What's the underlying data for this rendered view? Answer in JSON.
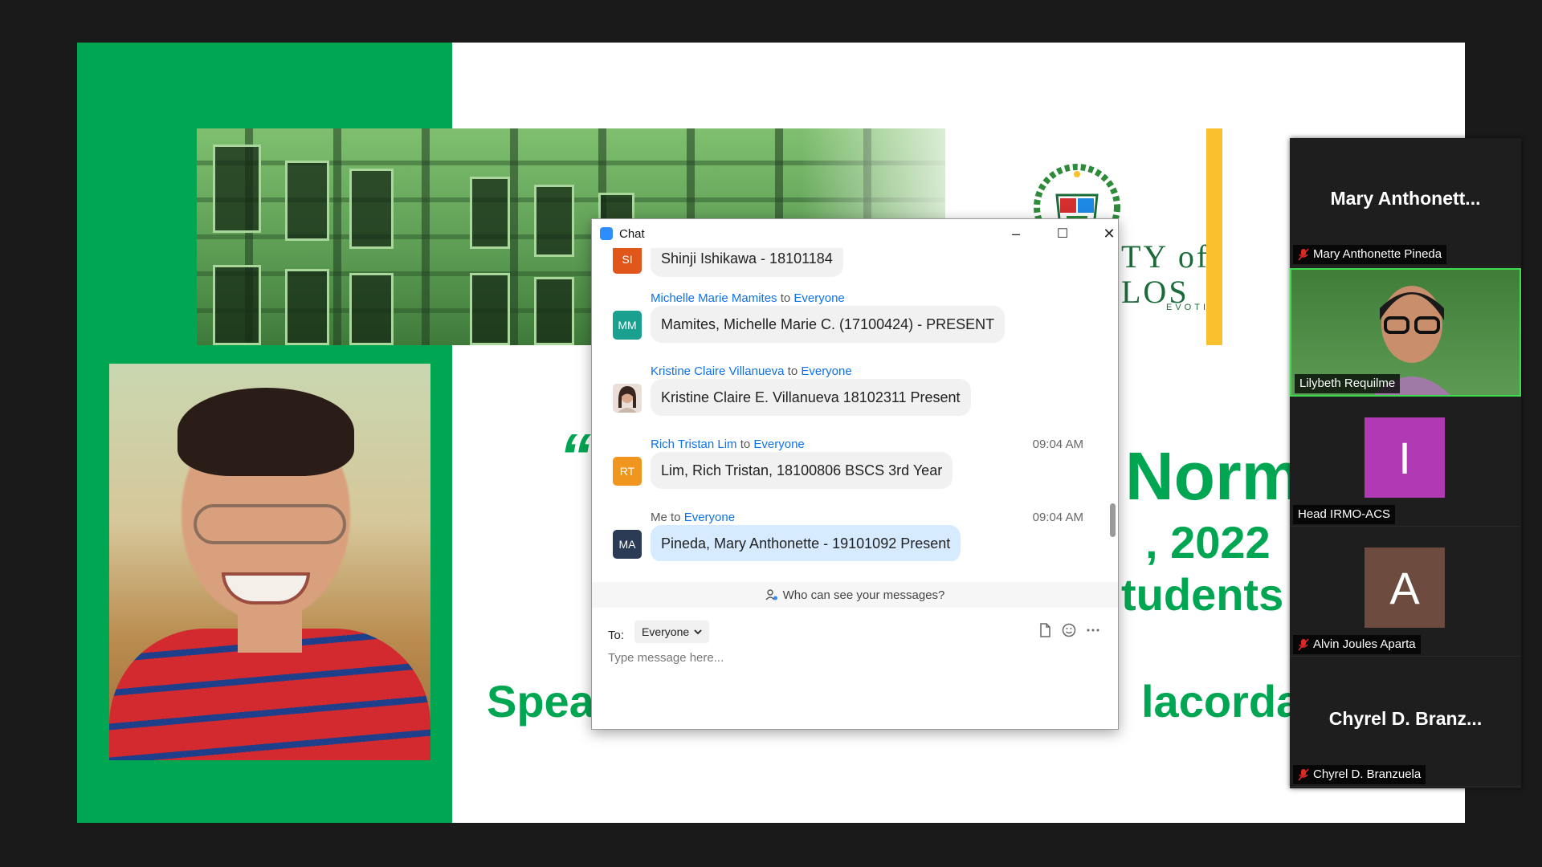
{
  "slide": {
    "logo_text": "TY of\nLOS",
    "logo_motto": "EVOTIO",
    "quote_mark": "“",
    "title_fragment": "Norma",
    "date_fragment": ", 2022",
    "audience_fragment": "tudents",
    "speaker_left": "Speak",
    "speaker_right": "lacorda, L"
  },
  "gallery": {
    "tiles": [
      {
        "big_name": "Mary  Anthonett...",
        "label": "Mary Anthonette Pineda",
        "muted": true
      },
      {
        "label": "Lilybeth Requilme",
        "video": true
      },
      {
        "avatar_letter": "I",
        "avatar_color": "#b03ab3",
        "label": "Head IRMO-ACS",
        "muted": false
      },
      {
        "avatar_letter": "A",
        "avatar_color": "#6d4c3f",
        "label": "Alvin Joules Aparta",
        "muted": true
      },
      {
        "big_name": "Chyrel  D.  Branz...",
        "label": "Chyrel D. Branzuela",
        "muted": true
      }
    ]
  },
  "chat": {
    "title": "Chat",
    "window_buttons": {
      "minimize": "–",
      "maximize": "☐",
      "close": "✕"
    },
    "messages": [
      {
        "avatar": "SI",
        "avatar_color": "#e0561b",
        "text": "Shinji Ishikawa - 18101184",
        "partial": true
      },
      {
        "sender": "Michelle Marie Mamites",
        "to": "to",
        "recipient": "Everyone",
        "avatar": "MM",
        "avatar_color": "#1aa08f",
        "text": "Mamites, Michelle Marie C. (17100424) - PRESENT"
      },
      {
        "sender": "Kristine Claire Villanueva",
        "to": "to",
        "recipient": "Everyone",
        "avatar": "",
        "avatar_color": "#7a5a4a",
        "text": "Kristine Claire E. Villanueva 18102311 Present"
      },
      {
        "sender": "Rich Tristan Lim",
        "to": "to",
        "recipient": "Everyone",
        "time": "09:04 AM",
        "avatar": "RT",
        "avatar_color": "#f0961e",
        "text": "Lim, Rich Tristan, 18100806 BSCS 3rd Year"
      },
      {
        "sender": "Me",
        "to": "to",
        "recipient": "Everyone",
        "time": "09:04 AM",
        "avatar": "MA",
        "avatar_color": "#2b3a55",
        "text": "Pineda, Mary Anthonette - 19101092 Present",
        "mine": true
      }
    ],
    "visibility_notice": "Who can see your messages?",
    "compose": {
      "to_label": "To:",
      "recipient": "Everyone",
      "placeholder": "Type message here..."
    }
  }
}
